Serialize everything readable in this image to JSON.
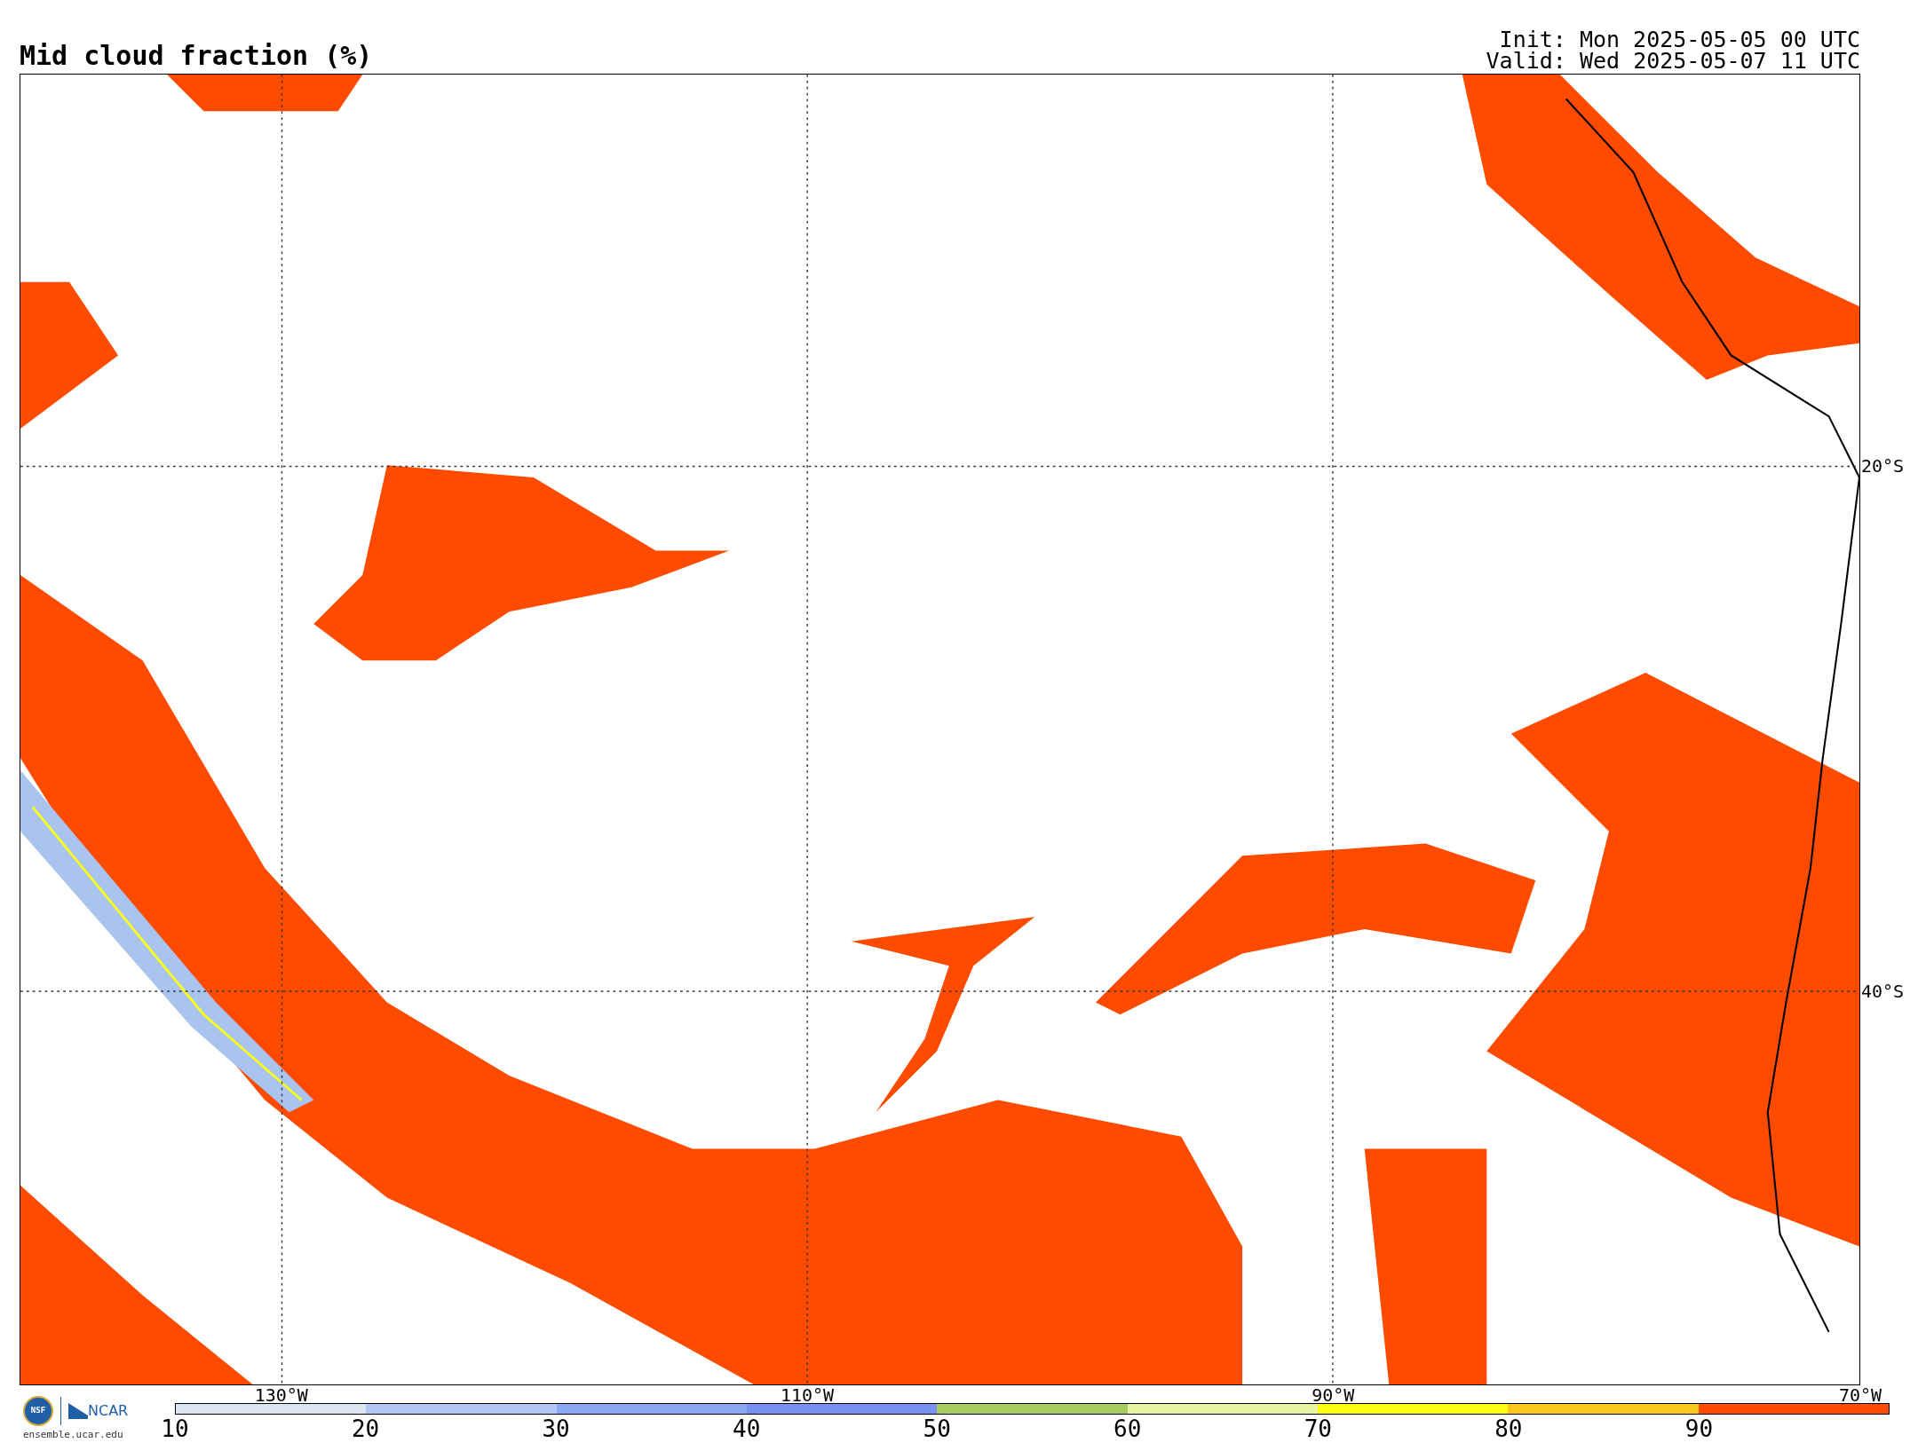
{
  "title": "Mid cloud fraction (%)",
  "run_info": [
    "Init: Mon 2025-05-05 00 UTC",
    "Valid: Wed 2025-05-07 11 UTC"
  ],
  "map": {
    "latitude_labels": [
      "20°S",
      "40°S"
    ],
    "longitude_labels": [
      "130°W",
      "110°W",
      "90°W",
      "70°W"
    ]
  },
  "logos": {
    "nsf": "NSF",
    "ncar": "NCAR",
    "url": "ensemble.ucar.edu"
  },
  "colorbar": {
    "segments": [
      {
        "color": "#dce6f0"
      },
      {
        "color": "#b4c8f5"
      },
      {
        "color": "#8ca8f5"
      },
      {
        "color": "#7890f0"
      },
      {
        "color": "#a8cc64"
      },
      {
        "color": "#e8f4a0"
      },
      {
        "color": "#ffff14"
      },
      {
        "color": "#fcc81e"
      },
      {
        "color": "#ff4b00"
      }
    ],
    "ticks": [
      "10",
      "20",
      "30",
      "40",
      "50",
      "60",
      "70",
      "80",
      "90"
    ]
  }
}
